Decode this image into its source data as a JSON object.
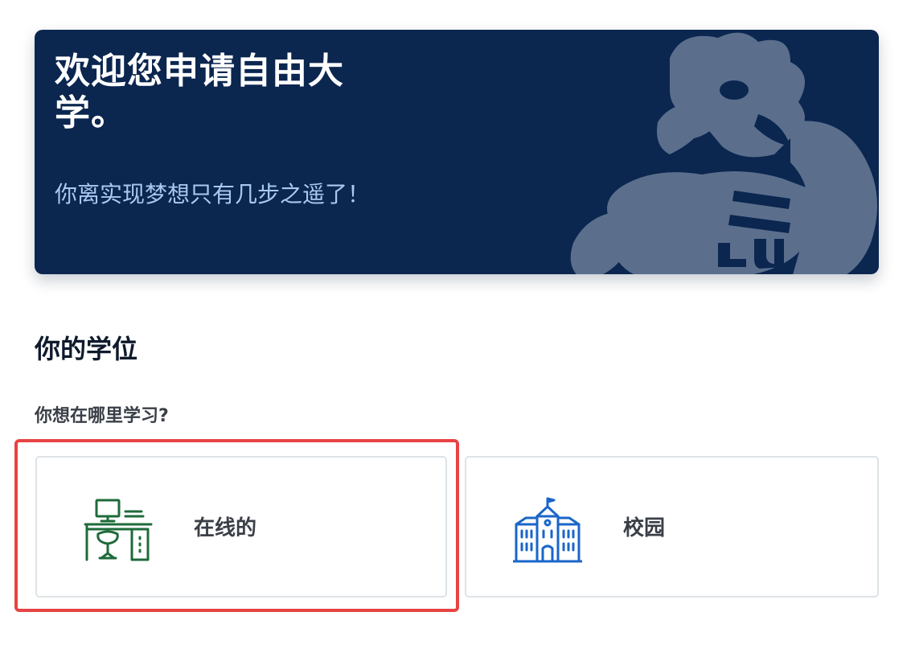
{
  "hero": {
    "title": "欢迎您申请自由大学。",
    "subtitle": "你离实现梦想只有几步之遥了！",
    "background_color": "#0b264f",
    "mascot_icon": "eagle-mascot-icon"
  },
  "section": {
    "title": "你的学位",
    "question": "你想在哪里学习?"
  },
  "options": [
    {
      "label": "在线的",
      "icon": "desk-computer-icon",
      "icon_color": "#1e6b3a",
      "selected": true
    },
    {
      "label": "校园",
      "icon": "campus-building-icon",
      "icon_color": "#1a66c9",
      "selected": false
    }
  ],
  "colors": {
    "selection_outline": "#e84343",
    "card_border": "#dde3e6"
  }
}
